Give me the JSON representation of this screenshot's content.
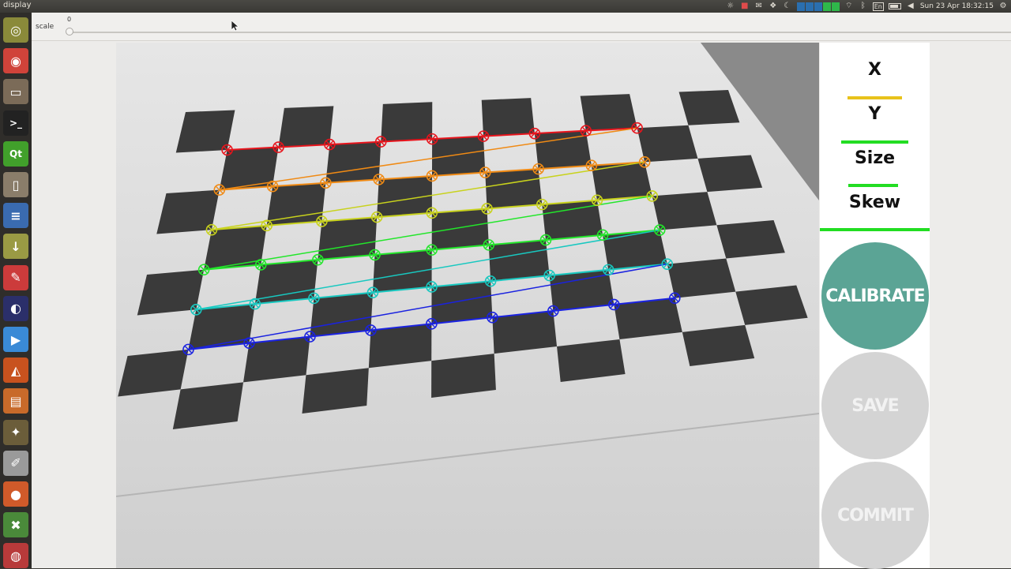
{
  "window": {
    "title": "display"
  },
  "tray": {
    "lang": "En",
    "clock": "Sun 23 Apr 18:32:15",
    "icons": [
      "bulb-icon",
      "camera-icon",
      "mail-icon",
      "dropbox-icon",
      "moon-icon",
      "network-bars",
      "wifi-icon",
      "bluetooth-icon",
      "lang-indicator",
      "battery-icon",
      "volume-icon",
      "clock",
      "gear-icon"
    ]
  },
  "launcher": {
    "items": [
      {
        "name": "dash",
        "glyph": "◎",
        "color": "#8a8a3a"
      },
      {
        "name": "chrome",
        "glyph": "◉",
        "color": "#d0433a"
      },
      {
        "name": "files",
        "glyph": "▭",
        "color": "#7b6b58"
      },
      {
        "name": "terminal",
        "glyph": ">_",
        "color": "#222222"
      },
      {
        "name": "qt-creator",
        "glyph": "Qt",
        "color": "#41a02b"
      },
      {
        "name": "reader",
        "glyph": "▯",
        "color": "#8a7d6a"
      },
      {
        "name": "writer",
        "glyph": "≡",
        "color": "#3a6bb0"
      },
      {
        "name": "downloads",
        "glyph": "↓",
        "color": "#9a9a44"
      },
      {
        "name": "document-viewer",
        "glyph": "✎",
        "color": "#cc3b3b"
      },
      {
        "name": "eclipse",
        "glyph": "◐",
        "color": "#2b2f6a"
      },
      {
        "name": "media-player",
        "glyph": "▶",
        "color": "#3a8ad6"
      },
      {
        "name": "matlab",
        "glyph": "◭",
        "color": "#c8521e"
      },
      {
        "name": "impress",
        "glyph": "▤",
        "color": "#c86a2a"
      },
      {
        "name": "gimp",
        "glyph": "✦",
        "color": "#6b5d3a"
      },
      {
        "name": "text-editor",
        "glyph": "✐",
        "color": "#9a9a9a"
      },
      {
        "name": "disk-tool",
        "glyph": "●",
        "color": "#d05a2a"
      },
      {
        "name": "archive-tool",
        "glyph": "✖",
        "color": "#4a8a3a"
      },
      {
        "name": "backup-tool",
        "glyph": "◍",
        "color": "#b83a3a"
      }
    ]
  },
  "toolbar": {
    "scale_label": "scale",
    "scale_value": "0"
  },
  "side_panel": {
    "metrics": [
      {
        "label": "X",
        "bar_fraction": 0.62,
        "bar_color": "#e8c21a"
      },
      {
        "label": "Y",
        "bar_fraction": 0.76,
        "bar_color": "#22dd22"
      },
      {
        "label": "Size",
        "bar_fraction": 0.57,
        "bar_color": "#22dd22"
      },
      {
        "label": "Skew",
        "bar_fraction": 1.0,
        "bar_color": "#22dd22"
      }
    ],
    "calibrate_label": "CALIBRATE",
    "save_label": "SAVE",
    "commit_label": "COMMIT",
    "calibrate_color": "#5ba495",
    "disabled_color": "#d4d4d4"
  }
}
